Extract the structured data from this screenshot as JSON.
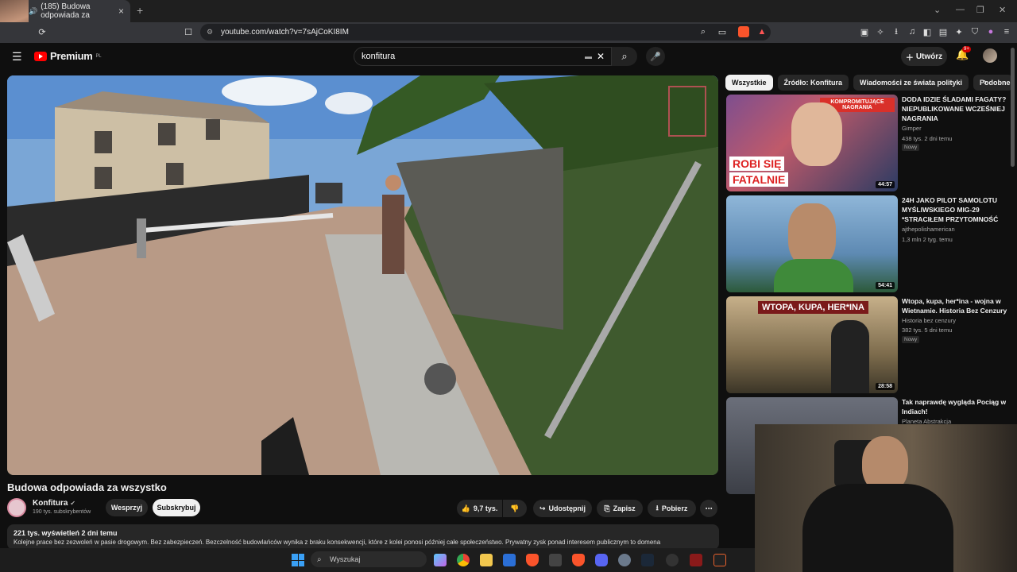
{
  "browser": {
    "tab_title": "(185) Budowa odpowiada za",
    "new_tab": "+",
    "url": "youtube.com/watch?v=7sAjCoKI8IM",
    "streamer_badge": "X2"
  },
  "header": {
    "logo_text": "Premium",
    "logo_sup": "PL",
    "search_value": "konfitura",
    "create_label": "Utwórz",
    "notif_count": "9+"
  },
  "video": {
    "title": "Budowa odpowiada za wszystko",
    "channel": "Konfitura",
    "subscribers": "190 tys. subskrybentów",
    "support_label": "Wesprzyj",
    "subscribe_label": "Subskrybuj",
    "likes": "9,7 tys.",
    "share_label": "Udostępnij",
    "save_label": "Zapisz",
    "download_label": "Pobierz",
    "views_meta": "221 tys. wyświetleń  2 dni temu",
    "description": "Kolejne prace bez zezwoleń w pasie drogowym. Bez zabezpieczeń. Bezczelność budowlańców wynika z braku konsekwencji, które z kolei ponosi później całe społeczeństwo. Prywatny zysk ponad interesem publicznym to domena"
  },
  "chips": [
    "Wszystkie",
    "Źródło: Konfitura",
    "Wiadomości ze świata polityki",
    "Podobne"
  ],
  "recommendations": [
    {
      "title": "DODA IDZIE ŚLADAMI FAGATY? NIEPUBLIKOWANE WCZEŚNIEJ NAGRANIA",
      "channel": "Gimper",
      "stats": "438 tys.  2 dni temu",
      "badge": "Nowy",
      "duration": "44:57",
      "thumb_text_1": "KOMPROMITUJĄCE NAGRANIA",
      "thumb_text_2": "ROBI SIĘ",
      "thumb_text_3": "FATALNIE"
    },
    {
      "title": "24H JAKO PILOT SAMOLOTU MYŚLIWSKIEGO MIG-29 *STRACIŁEM PRZYTOMNOŚĆ",
      "channel": "ajthepolishamerican",
      "stats": "1,3 mln  2 tyg. temu",
      "badge": "",
      "duration": "54:41"
    },
    {
      "title": "Wtopa, kupa, her*ina - wojna w Wietnamie. Historia Bez Cenzury",
      "channel": "Historia bez cenzury",
      "stats": "382 tys.  5 dni temu",
      "badge": "Nowy",
      "duration": "28:58",
      "thumb_text_1": "WTOPA, KUPA, HER*INA"
    },
    {
      "title": "Tak naprawdę wygląda Pociąg w Indiach!",
      "channel": "Planeta Abstrakcja",
      "stats": "",
      "badge": "",
      "duration": ""
    }
  ],
  "taskbar": {
    "search_placeholder": "Wyszukaj"
  },
  "colors": {
    "accent_red": "#ff0000",
    "background": "#0f0f0f",
    "surface": "#272727"
  }
}
